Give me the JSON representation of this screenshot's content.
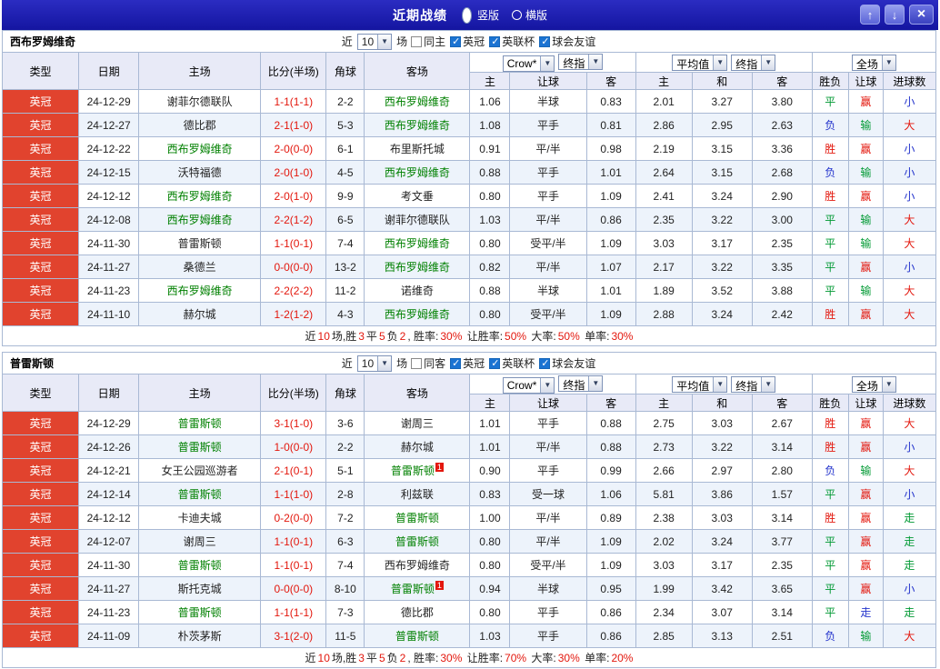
{
  "titlebar": {
    "title": "近期战绩",
    "radios": [
      {
        "label": "竖版",
        "selected": true
      },
      {
        "label": "横版",
        "selected": false
      }
    ],
    "up_icon": "↑",
    "down_icon": "↓",
    "close_icon": "×"
  },
  "controls": {
    "near": "近",
    "count": "10",
    "matches": "场",
    "leagues": [
      "英冠",
      "英联杯",
      "球会友谊"
    ],
    "odds_source": "Crow*",
    "final_odds": "终指",
    "average": "平均值",
    "full_match": "全场"
  },
  "headers": {
    "left": [
      "类型",
      "日期",
      "主场",
      "比分(半场)",
      "角球",
      "客场"
    ],
    "asia": [
      "主",
      "让球",
      "客"
    ],
    "euro": [
      "主",
      "和",
      "客"
    ],
    "result": [
      "胜负",
      "让球",
      "进球数"
    ]
  },
  "colors": {
    "titlebar_navy": "#1b1cab",
    "league_badge_red": "#e1432e",
    "win_red": "#e3170d",
    "draw_green": "#009933",
    "lose_blue": "#2333cc",
    "focus_team_green": "#008000"
  },
  "sections": [
    {
      "team": "西布罗姆维奇",
      "same_side_label": "同主",
      "rows": [
        {
          "league": "英冠",
          "date": "24-12-29",
          "home": "谢菲尔德联队",
          "away": "西布罗姆维奇",
          "focus": "away",
          "score": "1-1(1-1)",
          "corners": "2-2",
          "ah": [
            "1.06",
            "半球",
            "0.83"
          ],
          "eu": [
            "2.01",
            "3.27",
            "3.80"
          ],
          "res": [
            "平",
            "赢",
            "小"
          ]
        },
        {
          "league": "英冠",
          "date": "24-12-27",
          "home": "德比郡",
          "away": "西布罗姆维奇",
          "focus": "away",
          "score": "2-1(1-0)",
          "corners": "5-3",
          "ah": [
            "1.08",
            "平手",
            "0.81"
          ],
          "eu": [
            "2.86",
            "2.95",
            "2.63"
          ],
          "res": [
            "负",
            "输",
            "大"
          ]
        },
        {
          "league": "英冠",
          "date": "24-12-22",
          "home": "西布罗姆维奇",
          "away": "布里斯托城",
          "focus": "home",
          "score": "2-0(0-0)",
          "corners": "6-1",
          "ah": [
            "0.91",
            "平/半",
            "0.98"
          ],
          "eu": [
            "2.19",
            "3.15",
            "3.36"
          ],
          "res": [
            "胜",
            "赢",
            "小"
          ]
        },
        {
          "league": "英冠",
          "date": "24-12-15",
          "home": "沃特福德",
          "away": "西布罗姆维奇",
          "focus": "away",
          "score": "2-0(1-0)",
          "corners": "4-5",
          "ah": [
            "0.88",
            "平手",
            "1.01"
          ],
          "eu": [
            "2.64",
            "3.15",
            "2.68"
          ],
          "res": [
            "负",
            "输",
            "小"
          ]
        },
        {
          "league": "英冠",
          "date": "24-12-12",
          "home": "西布罗姆维奇",
          "away": "考文垂",
          "focus": "home",
          "score": "2-0(1-0)",
          "corners": "9-9",
          "ah": [
            "0.80",
            "平手",
            "1.09"
          ],
          "eu": [
            "2.41",
            "3.24",
            "2.90"
          ],
          "res": [
            "胜",
            "赢",
            "小"
          ]
        },
        {
          "league": "英冠",
          "date": "24-12-08",
          "home": "西布罗姆维奇",
          "away": "谢菲尔德联队",
          "focus": "home",
          "score": "2-2(1-2)",
          "corners": "6-5",
          "ah": [
            "1.03",
            "平/半",
            "0.86"
          ],
          "eu": [
            "2.35",
            "3.22",
            "3.00"
          ],
          "res": [
            "平",
            "输",
            "大"
          ]
        },
        {
          "league": "英冠",
          "date": "24-11-30",
          "home": "普雷斯顿",
          "away": "西布罗姆维奇",
          "focus": "away",
          "score": "1-1(0-1)",
          "corners": "7-4",
          "ah": [
            "0.80",
            "受平/半",
            "1.09"
          ],
          "eu": [
            "3.03",
            "3.17",
            "2.35"
          ],
          "res": [
            "平",
            "输",
            "大"
          ]
        },
        {
          "league": "英冠",
          "date": "24-11-27",
          "home": "桑德兰",
          "away": "西布罗姆维奇",
          "focus": "away",
          "score": "0-0(0-0)",
          "corners": "13-2",
          "ah": [
            "0.82",
            "平/半",
            "1.07"
          ],
          "eu": [
            "2.17",
            "3.22",
            "3.35"
          ],
          "res": [
            "平",
            "赢",
            "小"
          ]
        },
        {
          "league": "英冠",
          "date": "24-11-23",
          "home": "西布罗姆维奇",
          "away": "诺维奇",
          "focus": "home",
          "score": "2-2(2-2)",
          "corners": "11-2",
          "ah": [
            "0.88",
            "半球",
            "1.01"
          ],
          "eu": [
            "1.89",
            "3.52",
            "3.88"
          ],
          "res": [
            "平",
            "输",
            "大"
          ]
        },
        {
          "league": "英冠",
          "date": "24-11-10",
          "home": "赫尔城",
          "away": "西布罗姆维奇",
          "focus": "away",
          "score": "1-2(1-2)",
          "corners": "4-3",
          "ah": [
            "0.80",
            "受平/半",
            "1.09"
          ],
          "eu": [
            "2.88",
            "3.24",
            "2.42"
          ],
          "res": [
            "胜",
            "赢",
            "大"
          ]
        }
      ],
      "summary": [
        {
          "t": "近",
          "r": 0
        },
        {
          "t": "10",
          "r": 1
        },
        {
          "t": "场,胜",
          "r": 0
        },
        {
          "t": "3",
          "r": 1
        },
        {
          "t": "平",
          "r": 0
        },
        {
          "t": "5",
          "r": 1
        },
        {
          "t": "负",
          "r": 0
        },
        {
          "t": "2",
          "r": 1
        },
        {
          "t": ", 胜率:",
          "r": 0
        },
        {
          "t": "30%",
          "r": 1
        },
        {
          "t": " 让胜率:",
          "r": 0
        },
        {
          "t": "50%",
          "r": 1
        },
        {
          "t": " 大率:",
          "r": 0
        },
        {
          "t": "50%",
          "r": 1
        },
        {
          "t": " 单率:",
          "r": 0
        },
        {
          "t": "30%",
          "r": 1
        }
      ]
    },
    {
      "team": "普雷斯顿",
      "same_side_label": "同客",
      "rows": [
        {
          "league": "英冠",
          "date": "24-12-29",
          "home": "普雷斯顿",
          "away": "谢周三",
          "focus": "home",
          "score": "3-1(1-0)",
          "corners": "3-6",
          "ah": [
            "1.01",
            "平手",
            "0.88"
          ],
          "eu": [
            "2.75",
            "3.03",
            "2.67"
          ],
          "res": [
            "胜",
            "赢",
            "大"
          ]
        },
        {
          "league": "英冠",
          "date": "24-12-26",
          "home": "普雷斯顿",
          "away": "赫尔城",
          "focus": "home",
          "score": "1-0(0-0)",
          "corners": "2-2",
          "ah": [
            "1.01",
            "平/半",
            "0.88"
          ],
          "eu": [
            "2.73",
            "3.22",
            "3.14"
          ],
          "res": [
            "胜",
            "赢",
            "小"
          ]
        },
        {
          "league": "英冠",
          "date": "24-12-21",
          "home": "女王公园巡游者",
          "away": "普雷斯顿",
          "focus": "away",
          "away_card": "1",
          "score": "2-1(0-1)",
          "corners": "5-1",
          "ah": [
            "0.90",
            "平手",
            "0.99"
          ],
          "eu": [
            "2.66",
            "2.97",
            "2.80"
          ],
          "res": [
            "负",
            "输",
            "大"
          ]
        },
        {
          "league": "英冠",
          "date": "24-12-14",
          "home": "普雷斯顿",
          "away": "利兹联",
          "focus": "home",
          "score": "1-1(1-0)",
          "corners": "2-8",
          "ah": [
            "0.83",
            "受一球",
            "1.06"
          ],
          "eu": [
            "5.81",
            "3.86",
            "1.57"
          ],
          "res": [
            "平",
            "赢",
            "小"
          ]
        },
        {
          "league": "英冠",
          "date": "24-12-12",
          "home": "卡迪夫城",
          "away": "普雷斯顿",
          "focus": "away",
          "score": "0-2(0-0)",
          "corners": "7-2",
          "ah": [
            "1.00",
            "平/半",
            "0.89"
          ],
          "eu": [
            "2.38",
            "3.03",
            "3.14"
          ],
          "res": [
            "胜",
            "赢",
            "走"
          ]
        },
        {
          "league": "英冠",
          "date": "24-12-07",
          "home": "谢周三",
          "away": "普雷斯顿",
          "focus": "away",
          "score": "1-1(0-1)",
          "corners": "6-3",
          "ah": [
            "0.80",
            "平/半",
            "1.09"
          ],
          "eu": [
            "2.02",
            "3.24",
            "3.77"
          ],
          "res": [
            "平",
            "赢",
            "走"
          ]
        },
        {
          "league": "英冠",
          "date": "24-11-30",
          "home": "普雷斯顿",
          "away": "西布罗姆维奇",
          "focus": "home",
          "score": "1-1(0-1)",
          "corners": "7-4",
          "ah": [
            "0.80",
            "受平/半",
            "1.09"
          ],
          "eu": [
            "3.03",
            "3.17",
            "2.35"
          ],
          "res": [
            "平",
            "赢",
            "走"
          ]
        },
        {
          "league": "英冠",
          "date": "24-11-27",
          "home": "斯托克城",
          "away": "普雷斯顿",
          "focus": "away",
          "away_card": "1",
          "score": "0-0(0-0)",
          "corners": "8-10",
          "ah": [
            "0.94",
            "半球",
            "0.95"
          ],
          "eu": [
            "1.99",
            "3.42",
            "3.65"
          ],
          "res": [
            "平",
            "赢",
            "小"
          ]
        },
        {
          "league": "英冠",
          "date": "24-11-23",
          "home": "普雷斯顿",
          "away": "德比郡",
          "focus": "home",
          "score": "1-1(1-1)",
          "corners": "7-3",
          "ah": [
            "0.80",
            "平手",
            "0.86"
          ],
          "eu": [
            "2.34",
            "3.07",
            "3.14"
          ],
          "res": [
            "平",
            "走",
            "走"
          ]
        },
        {
          "league": "英冠",
          "date": "24-11-09",
          "home": "朴茨茅斯",
          "away": "普雷斯顿",
          "focus": "away",
          "score": "3-1(2-0)",
          "corners": "11-5",
          "ah": [
            "1.03",
            "平手",
            "0.86"
          ],
          "eu": [
            "2.85",
            "3.13",
            "2.51"
          ],
          "res": [
            "负",
            "输",
            "大"
          ]
        }
      ],
      "summary": [
        {
          "t": "近",
          "r": 0
        },
        {
          "t": "10",
          "r": 1
        },
        {
          "t": "场,胜",
          "r": 0
        },
        {
          "t": "3",
          "r": 1
        },
        {
          "t": "平",
          "r": 0
        },
        {
          "t": "5",
          "r": 1
        },
        {
          "t": "负",
          "r": 0
        },
        {
          "t": "2",
          "r": 1
        },
        {
          "t": ", 胜率:",
          "r": 0
        },
        {
          "t": "30%",
          "r": 1
        },
        {
          "t": " 让胜率:",
          "r": 0
        },
        {
          "t": "70%",
          "r": 1
        },
        {
          "t": " 大率:",
          "r": 0
        },
        {
          "t": "30%",
          "r": 1
        },
        {
          "t": " 单率:",
          "r": 0
        },
        {
          "t": "20%",
          "r": 1
        }
      ]
    }
  ]
}
